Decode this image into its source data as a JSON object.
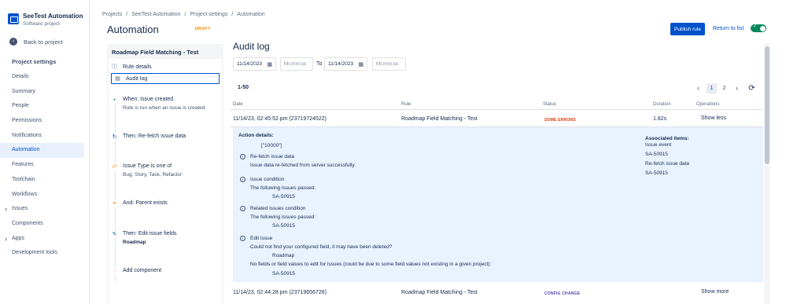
{
  "project": {
    "name": "SeeTest Automation",
    "type": "Software project"
  },
  "sidebar": {
    "back_label": "Back to project",
    "section_title": "Project settings",
    "items": [
      {
        "label": "Details"
      },
      {
        "label": "Summary"
      },
      {
        "label": "People"
      },
      {
        "label": "Permissions"
      },
      {
        "label": "Notifications"
      },
      {
        "label": "Automation"
      },
      {
        "label": "Features"
      },
      {
        "label": "Toolchain"
      },
      {
        "label": "Workflows"
      },
      {
        "label": "Issues"
      },
      {
        "label": "Components"
      },
      {
        "label": "Apps"
      },
      {
        "label": "Development tools"
      }
    ]
  },
  "breadcrumbs": [
    "Projects",
    "SeeTest Automation",
    "Project settings",
    "Automation"
  ],
  "header": {
    "title": "Automation",
    "draft": "DRAFT",
    "publish": "Publish rule",
    "return": "Return to list"
  },
  "flow": {
    "rule_name": "Roadmap Field Matching - Test",
    "rule_details": "Rule details",
    "audit_log": "Audit log",
    "steps": [
      {
        "title": "When: Issue created",
        "sub": "Rule is run when an issue is created."
      },
      {
        "title": "Then: Re-fetch issue data",
        "sub": ""
      },
      {
        "title": "Issue Type is one of",
        "sub": "Bug, Story, Task, Refactor"
      },
      {
        "title": "And: Parent exists",
        "sub": ""
      },
      {
        "title": "Then: Edit issue fields",
        "sub": "Roadmap"
      },
      {
        "title": "Add component",
        "sub": ""
      }
    ]
  },
  "audit": {
    "title": "Audit log",
    "from_date": "11/14/2023",
    "from_time": "hh:mm:ss",
    "to_label": "To",
    "to_date": "11/14/2023",
    "to_time": "hh:mm:ss",
    "range": "1-50",
    "pages": [
      "1",
      "2"
    ],
    "columns": {
      "date": "Date",
      "rule": "Rule",
      "status": "Status",
      "duration": "Duration",
      "operations": "Operations"
    },
    "rows": [
      {
        "date": "11/14/23, 02:45:52 pm (23719724522)",
        "rule": "Roadmap Field Matching - Test",
        "status": "SOME ERRORS",
        "duration": "1.82s",
        "op": "Show less"
      },
      {
        "date": "11/14/23, 02:44:28 pm (23719656726)",
        "rule": "Roadmap Field Matching - Test",
        "status": "CONFIG CHANGE",
        "duration": "",
        "op": "Show more"
      }
    ],
    "details": {
      "heading": "Action details:",
      "value": "[\"10000\"]",
      "refetch_title": "Re-fetch issue data",
      "refetch_msg": "Issue data re-fetched from server successfully.",
      "cond_title": "Issue condition",
      "cond_msg": "The following issues passed:",
      "cond_issue": "SA-50915",
      "rel_title": "Related issues condition",
      "rel_msg": "The following issues passed:",
      "rel_issue": "SA-50915",
      "edit_title": "Edit issue",
      "edit_msg": "Could not find your configured field, it may have been deleted?",
      "edit_field": "Roadmap",
      "edit_msg2": "No fields or field values to edit for issues (could be due to some field values not existing in a given project):",
      "edit_issue": "SA-50915",
      "assoc_title": "Associated items:",
      "assoc_event": "Issue event",
      "assoc_event_issue": "SA-50915",
      "assoc_refetch": "Re-fetch issue data",
      "assoc_refetch_issue": "SA-50915"
    }
  },
  "colors": {
    "accent": "#0052cc",
    "success": "#00875a",
    "error": "#de350b",
    "draft": "#ff8b00",
    "detail_bg": "#e9f2ff"
  }
}
